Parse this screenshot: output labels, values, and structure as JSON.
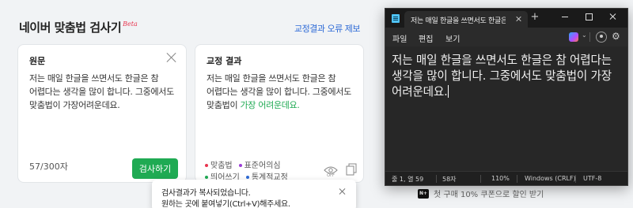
{
  "naver": {
    "title": "네이버 맞춤법 검사기",
    "beta": "Beta",
    "report_link": "교정결과 오류 제보",
    "original": {
      "title": "원문",
      "text": "저는 매일 한글을 쓰면서도 한글은 참 어렵다는 생각을 많이 합니다. 그중에서도 맞춤법이 가장어려운데요.",
      "counter": "57/300자",
      "check_button": "검사하기"
    },
    "result": {
      "title": "교정 결과",
      "text_plain": "저는 매일 한글을 쓰면서도 한글은 참 어렵다는 생각을 많이 합니다. 그중에서도 맞춤법이 ",
      "text_corrected": "가장 어려운데요."
    },
    "legend": [
      {
        "label": "맞춤법",
        "color": "#e8344e"
      },
      {
        "label": "표준어의심",
        "color": "#9b3dd6"
      },
      {
        "label": "띄어쓰기",
        "color": "#1faa53"
      },
      {
        "label": "통계적교정",
        "color": "#2d6ad6"
      }
    ],
    "eye_off_label": "OFF",
    "toast": {
      "line1": "검사결과가 복사되었습니다.",
      "line2": "원하는 곳에 붙여넣기(Ctrl+V)해주세요."
    },
    "promo": {
      "logo": "N+",
      "text": "첫 구매 10% 쿠폰으로 할인 받기"
    }
  },
  "notepad": {
    "tab_title": "저는 매일 한글을 쓰면서도 한글은",
    "new_tab": "+",
    "menu": [
      "파일",
      "편집",
      "보기"
    ],
    "content": "저는 매일 한글을 쓰면서도 한글은 참 어렵다는 생각을 많이 합니다. 그중에서도 맞춤법이 가장 어려운데요.",
    "status": {
      "position": "줄 1, 열 59",
      "chars": "58자",
      "zoom": "110%",
      "line_ending": "Windows (CRLF)",
      "encoding": "UTF-8"
    }
  }
}
